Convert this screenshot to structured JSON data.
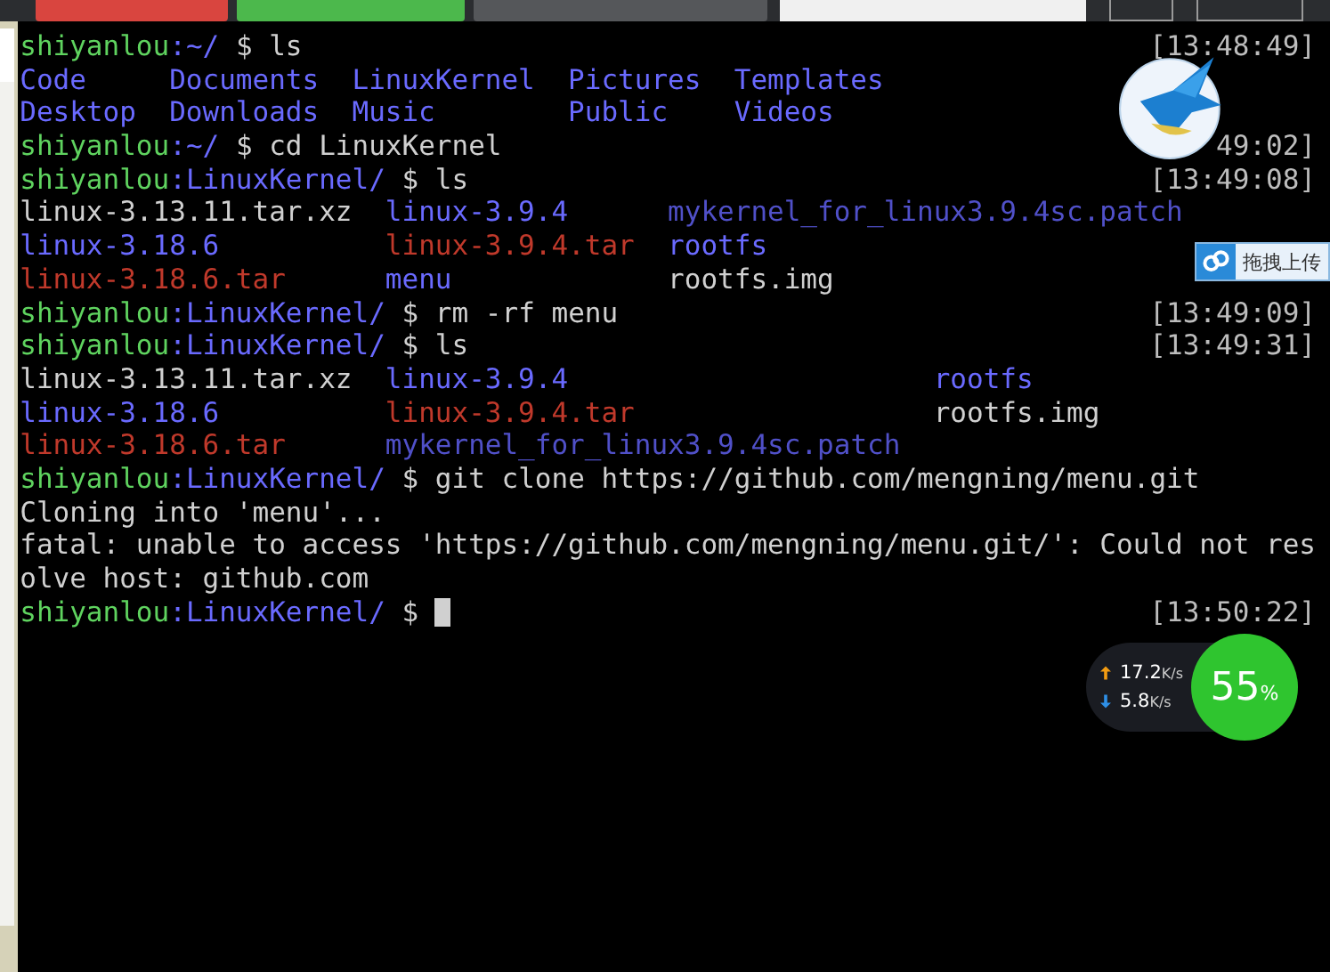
{
  "toolbar": {
    "buttons": [
      {
        "color": "#d9453f"
      },
      {
        "color": "#4cb84c"
      },
      {
        "color": "#55575a"
      }
    ]
  },
  "terminal": {
    "lines": [
      {
        "kind": "prompt",
        "user": "shiyanlou",
        "path": ":~/",
        "command": " $ ls",
        "time": "[13:48:49]"
      },
      {
        "kind": "listing",
        "rows": [
          [
            {
              "name": "Code",
              "kind": "dir"
            },
            {
              "name": "Documents",
              "kind": "dir"
            },
            {
              "name": "LinuxKernel",
              "kind": "dir"
            },
            {
              "name": "Pictures",
              "kind": "dir"
            },
            {
              "name": "Templates",
              "kind": "dir"
            }
          ],
          [
            {
              "name": "Desktop",
              "kind": "dir"
            },
            {
              "name": "Downloads",
              "kind": "dir"
            },
            {
              "name": "Music",
              "kind": "dir"
            },
            {
              "name": "Public",
              "kind": "dir"
            },
            {
              "name": "Videos",
              "kind": "dir"
            }
          ]
        ]
      },
      {
        "kind": "prompt",
        "user": "shiyanlou",
        "path": ":~/",
        "command": " $ cd LinuxKernel",
        "time": "49:02]"
      },
      {
        "kind": "prompt",
        "user": "shiyanlou",
        "path": ":LinuxKernel/",
        "command": " $ ls",
        "time": "[13:49:08]"
      },
      {
        "kind": "listing",
        "rows": [
          [
            {
              "name": "linux-3.13.11.tar.xz",
              "kind": "file"
            },
            {
              "name": "linux-3.9.4",
              "kind": "dir"
            },
            {
              "name": "mykernel_for_linux3.9.4sc.patch",
              "kind": "patch"
            }
          ],
          [
            {
              "name": "linux-3.18.6",
              "kind": "dir"
            },
            {
              "name": "linux-3.9.4.tar",
              "kind": "archive"
            },
            {
              "name": "rootfs",
              "kind": "dir"
            }
          ],
          [
            {
              "name": "linux-3.18.6.tar",
              "kind": "archive"
            },
            {
              "name": "menu",
              "kind": "dir"
            },
            {
              "name": "rootfs.img",
              "kind": "file"
            }
          ]
        ]
      },
      {
        "kind": "prompt",
        "user": "shiyanlou",
        "path": ":LinuxKernel/",
        "command": " $ rm -rf menu",
        "time": "[13:49:09]"
      },
      {
        "kind": "prompt",
        "user": "shiyanlou",
        "path": ":LinuxKernel/",
        "command": " $ ls",
        "time": "[13:49:31]"
      },
      {
        "kind": "listing",
        "rows": [
          [
            {
              "name": "linux-3.13.11.tar.xz",
              "kind": "file"
            },
            {
              "name": "linux-3.9.4",
              "kind": "dir"
            },
            {
              "name": "rootfs",
              "kind": "dir"
            }
          ],
          [
            {
              "name": "linux-3.18.6",
              "kind": "dir"
            },
            {
              "name": "linux-3.9.4.tar",
              "kind": "archive"
            },
            {
              "name": "rootfs.img",
              "kind": "file"
            }
          ],
          [
            {
              "name": "linux-3.18.6.tar",
              "kind": "archive"
            },
            {
              "name": "mykernel_for_linux3.9.4sc.patch",
              "kind": "patch"
            }
          ]
        ]
      },
      {
        "kind": "prompt",
        "user": "shiyanlou",
        "path": ":LinuxKernel/",
        "command": " $ git clone https://github.com/mengning/menu.git"
      },
      {
        "kind": "output",
        "text": "Cloning into 'menu'..."
      },
      {
        "kind": "output",
        "text": "fatal: unable to access 'https://github.com/mengning/menu.git/': Could not res"
      },
      {
        "kind": "output",
        "text": "olve host: github.com"
      },
      {
        "kind": "prompt",
        "user": "shiyanlou",
        "path": ":LinuxKernel/",
        "command": " $ ",
        "cursor": true,
        "time": "[13:50:22]"
      }
    ]
  },
  "upload_button": {
    "label": "拖拽上传"
  },
  "speed_widget": {
    "upload": "17.2",
    "upload_unit": "K/s",
    "download": "5.8",
    "download_unit": "K/s",
    "percent": "55",
    "percent_unit": "%"
  }
}
